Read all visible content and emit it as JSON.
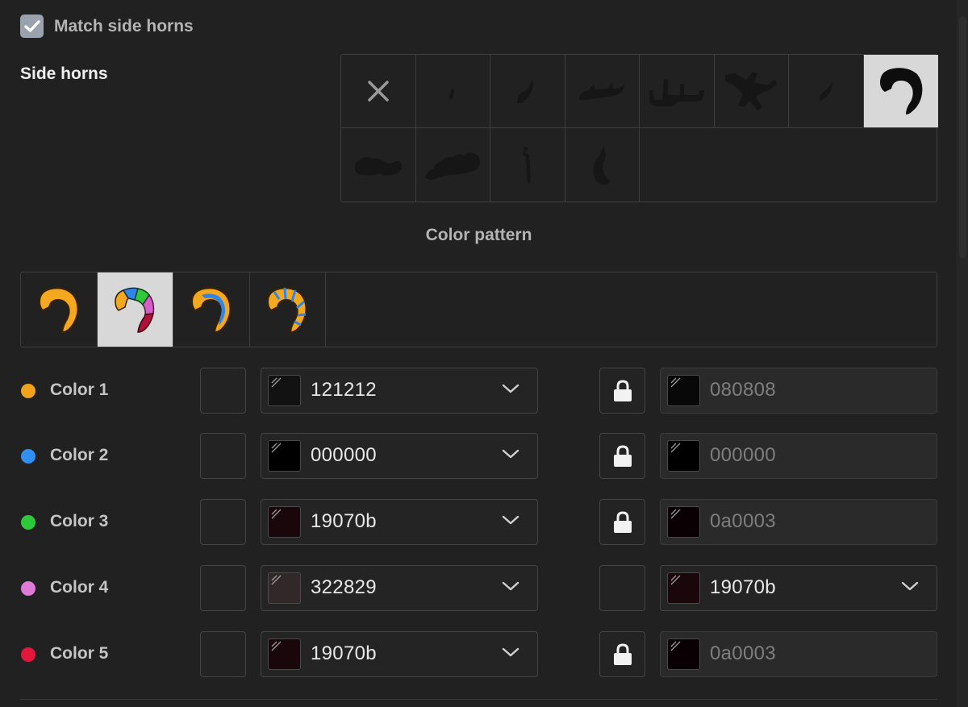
{
  "match": {
    "label": "Match side horns",
    "checked": true
  },
  "section_title": "Side horns",
  "pattern_title": "Color pattern",
  "horn_options": [
    {
      "icon": "none-x-icon"
    },
    {
      "icon": "horn-shape-1-icon"
    },
    {
      "icon": "horn-shape-2-icon"
    },
    {
      "icon": "horn-shape-3-icon"
    },
    {
      "icon": "horn-shape-4-icon"
    },
    {
      "icon": "horn-shape-5-icon"
    },
    {
      "icon": "horn-shape-6-icon"
    },
    {
      "icon": "horn-shape-7-icon",
      "selected": true
    },
    {
      "icon": "horn-shape-8-icon"
    },
    {
      "icon": "horn-shape-9-icon"
    },
    {
      "icon": "horn-shape-10-icon"
    },
    {
      "icon": "horn-shape-11-icon"
    }
  ],
  "patterns": [
    {
      "icon": "pattern-solid-icon"
    },
    {
      "icon": "pattern-multicolor-icon",
      "selected": true
    },
    {
      "icon": "pattern-stripe-icon"
    },
    {
      "icon": "pattern-bands-icon"
    }
  ],
  "colors": [
    {
      "label": "Color 1",
      "dot": "#f0a21b",
      "value": "121212",
      "swatch": "#121212",
      "locked": true,
      "secondary": "080808",
      "secondary_swatch": "#080808"
    },
    {
      "label": "Color 2",
      "dot": "#2f8ff2",
      "value": "000000",
      "swatch": "#000000",
      "locked": true,
      "secondary": "000000",
      "secondary_swatch": "#000000"
    },
    {
      "label": "Color 3",
      "dot": "#2ec93a",
      "value": "19070b",
      "swatch": "#19070b",
      "locked": true,
      "secondary": "0a0003",
      "secondary_swatch": "#0a0003"
    },
    {
      "label": "Color 4",
      "dot": "#e07ad8",
      "value": "322829",
      "swatch": "#322829",
      "locked": false,
      "secondary": "19070b",
      "secondary_swatch": "#19070b"
    },
    {
      "label": "Color 5",
      "dot": "#e3173c",
      "value": "19070b",
      "swatch": "#19070b",
      "locked": true,
      "secondary": "0a0003",
      "secondary_swatch": "#0a0003"
    }
  ]
}
